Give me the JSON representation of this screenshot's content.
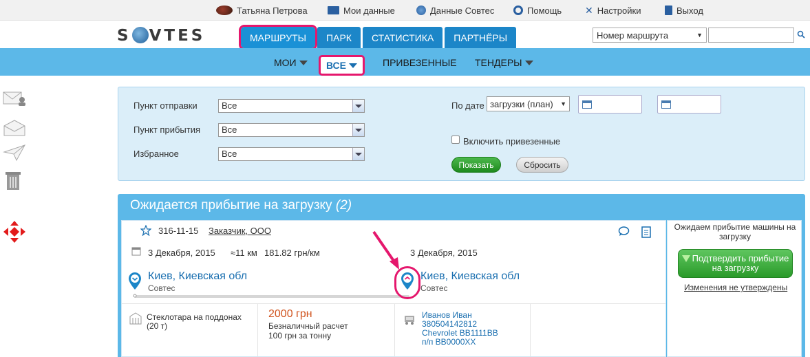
{
  "topbar": {
    "user_name": "Татьяна Петрова",
    "my_data": "Мои данные",
    "sovtes_data": "Данные Совтес",
    "help": "Помощь",
    "settings": "Настройки",
    "logout": "Выход"
  },
  "header": {
    "logo_left": "S",
    "logo_right": "VTES",
    "tabs": [
      "МАРШРУТЫ",
      "ПАРК",
      "СТАТИСТИКА",
      "ПАРТНЁРЫ"
    ],
    "search_select": "Номер маршрута"
  },
  "subnav": {
    "mine": "МОИ",
    "all": "ВСЕ",
    "delivered": "ПРИВЕЗЕННЫЕ",
    "tenders": "ТЕНДЕРЫ"
  },
  "filter": {
    "departure_label": "Пункт отправки",
    "departure_value": "Все",
    "arrival_label": "Пункт прибытия",
    "arrival_value": "Все",
    "favorite_label": "Избранное",
    "favorite_value": "Все",
    "by_date_label": "По дате",
    "date_type": "загрузки (план)",
    "include_delivered": "Включить привезенные",
    "show_button": "Показать",
    "reset_button": "Сбросить"
  },
  "section": {
    "title": "Ожидается прибытие на загрузку",
    "count": "(2)"
  },
  "route": {
    "number": "316-11-15",
    "customer": "Заказчик, ООО",
    "date_from": "3 Декабря, 2015",
    "distance": "≈11 км",
    "rate": "181.82 грн/км",
    "date_to": "3 Декабря, 2015",
    "from_city": "Киев, Киевская обл",
    "from_company": "Совтес",
    "to_city": "Киев, Киевская обл",
    "to_company": "Совтес",
    "cargo_line1": "Стеклотара на поддонах",
    "cargo_line2": "(20 т)",
    "price": "2000 грн",
    "payment": "Безналичный расчет",
    "price_per_ton": "100 грн за тонну",
    "driver": "Иванов Иван",
    "phone": "380504142812",
    "vehicle": "Chevrolet BB1111BB",
    "trailer": "п/п BB0000XX"
  },
  "status": {
    "text": "Ожидаем прибытие машины на загрузку",
    "confirm_button": "Подтвердить прибытие на загрузку",
    "changes_link": "Изменения не утверждены"
  },
  "colors": {
    "accent_blue": "#1c86c8",
    "light_blue": "#5cb8e8",
    "highlight": "#e5176d",
    "green": "#2a9a2a",
    "price_orange": "#d0521c"
  }
}
